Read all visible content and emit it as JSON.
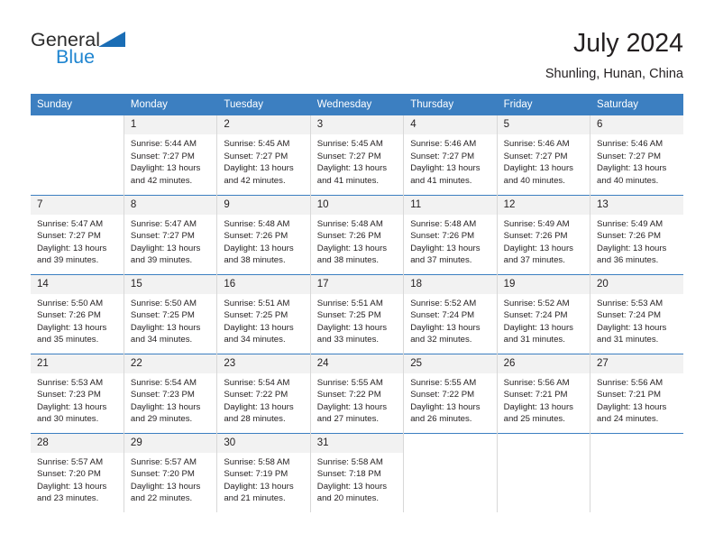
{
  "brand": {
    "name_top": "General",
    "name_bottom": "Blue",
    "triangle_color": "#1a6db5",
    "blue_color": "#1f85d0"
  },
  "header": {
    "title": "July 2024",
    "subtitle": "Shunling, Hunan, China"
  },
  "theme": {
    "header_bg": "#3c7fc1",
    "header_text": "#ffffff",
    "daynum_bg": "#f2f2f2",
    "cell_border": "#d8d8d8",
    "text": "#231f20"
  },
  "weekdays": [
    "Sunday",
    "Monday",
    "Tuesday",
    "Wednesday",
    "Thursday",
    "Friday",
    "Saturday"
  ],
  "labels": {
    "sunrise_prefix": "Sunrise:",
    "sunset_prefix": "Sunset:",
    "daylight_prefix": "Daylight:"
  },
  "weeks": [
    [
      {
        "day": "",
        "sunrise": "",
        "sunset": "",
        "daylight": ""
      },
      {
        "day": "1",
        "sunrise": "Sunrise: 5:44 AM",
        "sunset": "Sunset: 7:27 PM",
        "daylight": "Daylight: 13 hours and 42 minutes."
      },
      {
        "day": "2",
        "sunrise": "Sunrise: 5:45 AM",
        "sunset": "Sunset: 7:27 PM",
        "daylight": "Daylight: 13 hours and 42 minutes."
      },
      {
        "day": "3",
        "sunrise": "Sunrise: 5:45 AM",
        "sunset": "Sunset: 7:27 PM",
        "daylight": "Daylight: 13 hours and 41 minutes."
      },
      {
        "day": "4",
        "sunrise": "Sunrise: 5:46 AM",
        "sunset": "Sunset: 7:27 PM",
        "daylight": "Daylight: 13 hours and 41 minutes."
      },
      {
        "day": "5",
        "sunrise": "Sunrise: 5:46 AM",
        "sunset": "Sunset: 7:27 PM",
        "daylight": "Daylight: 13 hours and 40 minutes."
      },
      {
        "day": "6",
        "sunrise": "Sunrise: 5:46 AM",
        "sunset": "Sunset: 7:27 PM",
        "daylight": "Daylight: 13 hours and 40 minutes."
      }
    ],
    [
      {
        "day": "7",
        "sunrise": "Sunrise: 5:47 AM",
        "sunset": "Sunset: 7:27 PM",
        "daylight": "Daylight: 13 hours and 39 minutes."
      },
      {
        "day": "8",
        "sunrise": "Sunrise: 5:47 AM",
        "sunset": "Sunset: 7:27 PM",
        "daylight": "Daylight: 13 hours and 39 minutes."
      },
      {
        "day": "9",
        "sunrise": "Sunrise: 5:48 AM",
        "sunset": "Sunset: 7:26 PM",
        "daylight": "Daylight: 13 hours and 38 minutes."
      },
      {
        "day": "10",
        "sunrise": "Sunrise: 5:48 AM",
        "sunset": "Sunset: 7:26 PM",
        "daylight": "Daylight: 13 hours and 38 minutes."
      },
      {
        "day": "11",
        "sunrise": "Sunrise: 5:48 AM",
        "sunset": "Sunset: 7:26 PM",
        "daylight": "Daylight: 13 hours and 37 minutes."
      },
      {
        "day": "12",
        "sunrise": "Sunrise: 5:49 AM",
        "sunset": "Sunset: 7:26 PM",
        "daylight": "Daylight: 13 hours and 37 minutes."
      },
      {
        "day": "13",
        "sunrise": "Sunrise: 5:49 AM",
        "sunset": "Sunset: 7:26 PM",
        "daylight": "Daylight: 13 hours and 36 minutes."
      }
    ],
    [
      {
        "day": "14",
        "sunrise": "Sunrise: 5:50 AM",
        "sunset": "Sunset: 7:26 PM",
        "daylight": "Daylight: 13 hours and 35 minutes."
      },
      {
        "day": "15",
        "sunrise": "Sunrise: 5:50 AM",
        "sunset": "Sunset: 7:25 PM",
        "daylight": "Daylight: 13 hours and 34 minutes."
      },
      {
        "day": "16",
        "sunrise": "Sunrise: 5:51 AM",
        "sunset": "Sunset: 7:25 PM",
        "daylight": "Daylight: 13 hours and 34 minutes."
      },
      {
        "day": "17",
        "sunrise": "Sunrise: 5:51 AM",
        "sunset": "Sunset: 7:25 PM",
        "daylight": "Daylight: 13 hours and 33 minutes."
      },
      {
        "day": "18",
        "sunrise": "Sunrise: 5:52 AM",
        "sunset": "Sunset: 7:24 PM",
        "daylight": "Daylight: 13 hours and 32 minutes."
      },
      {
        "day": "19",
        "sunrise": "Sunrise: 5:52 AM",
        "sunset": "Sunset: 7:24 PM",
        "daylight": "Daylight: 13 hours and 31 minutes."
      },
      {
        "day": "20",
        "sunrise": "Sunrise: 5:53 AM",
        "sunset": "Sunset: 7:24 PM",
        "daylight": "Daylight: 13 hours and 31 minutes."
      }
    ],
    [
      {
        "day": "21",
        "sunrise": "Sunrise: 5:53 AM",
        "sunset": "Sunset: 7:23 PM",
        "daylight": "Daylight: 13 hours and 30 minutes."
      },
      {
        "day": "22",
        "sunrise": "Sunrise: 5:54 AM",
        "sunset": "Sunset: 7:23 PM",
        "daylight": "Daylight: 13 hours and 29 minutes."
      },
      {
        "day": "23",
        "sunrise": "Sunrise: 5:54 AM",
        "sunset": "Sunset: 7:22 PM",
        "daylight": "Daylight: 13 hours and 28 minutes."
      },
      {
        "day": "24",
        "sunrise": "Sunrise: 5:55 AM",
        "sunset": "Sunset: 7:22 PM",
        "daylight": "Daylight: 13 hours and 27 minutes."
      },
      {
        "day": "25",
        "sunrise": "Sunrise: 5:55 AM",
        "sunset": "Sunset: 7:22 PM",
        "daylight": "Daylight: 13 hours and 26 minutes."
      },
      {
        "day": "26",
        "sunrise": "Sunrise: 5:56 AM",
        "sunset": "Sunset: 7:21 PM",
        "daylight": "Daylight: 13 hours and 25 minutes."
      },
      {
        "day": "27",
        "sunrise": "Sunrise: 5:56 AM",
        "sunset": "Sunset: 7:21 PM",
        "daylight": "Daylight: 13 hours and 24 minutes."
      }
    ],
    [
      {
        "day": "28",
        "sunrise": "Sunrise: 5:57 AM",
        "sunset": "Sunset: 7:20 PM",
        "daylight": "Daylight: 13 hours and 23 minutes."
      },
      {
        "day": "29",
        "sunrise": "Sunrise: 5:57 AM",
        "sunset": "Sunset: 7:20 PM",
        "daylight": "Daylight: 13 hours and 22 minutes."
      },
      {
        "day": "30",
        "sunrise": "Sunrise: 5:58 AM",
        "sunset": "Sunset: 7:19 PM",
        "daylight": "Daylight: 13 hours and 21 minutes."
      },
      {
        "day": "31",
        "sunrise": "Sunrise: 5:58 AM",
        "sunset": "Sunset: 7:18 PM",
        "daylight": "Daylight: 13 hours and 20 minutes."
      },
      {
        "day": "",
        "sunrise": "",
        "sunset": "",
        "daylight": ""
      },
      {
        "day": "",
        "sunrise": "",
        "sunset": "",
        "daylight": ""
      },
      {
        "day": "",
        "sunrise": "",
        "sunset": "",
        "daylight": ""
      }
    ]
  ]
}
